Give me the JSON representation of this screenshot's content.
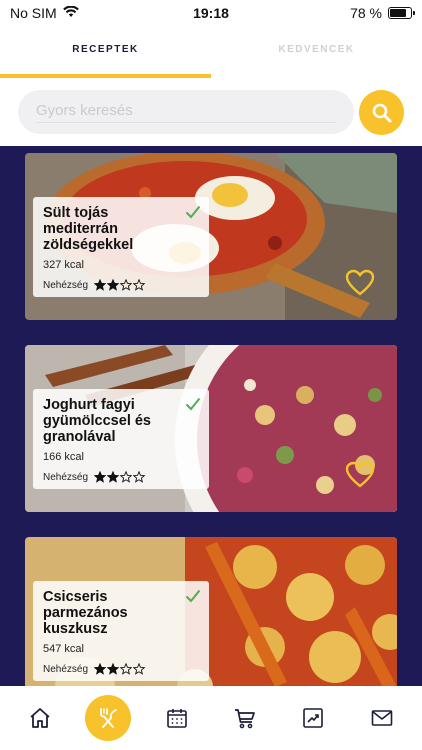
{
  "status_bar": {
    "carrier": "No SIM",
    "time": "19:18",
    "battery": "78 %",
    "battery_level": 0.78
  },
  "tabs": [
    {
      "label": "RECEPTEK",
      "active": true
    },
    {
      "label": "KEDVENCEK",
      "active": false
    }
  ],
  "search": {
    "placeholder": "Gyors keresés",
    "value": ""
  },
  "recipes": [
    {
      "title": "Sült tojás mediterrán zöldségekkel",
      "kcal": "327 kcal",
      "difficulty_label": "Nehézség",
      "difficulty": 2,
      "difficulty_max": 4
    },
    {
      "title": "Joghurt fagyi gyümölccsel és granolával",
      "kcal": "166 kcal",
      "difficulty_label": "Nehézség",
      "difficulty": 2,
      "difficulty_max": 4
    },
    {
      "title": "Csicseris parmezános kuszkusz",
      "kcal": "547 kcal",
      "difficulty_label": "Nehézség",
      "difficulty": 2,
      "difficulty_max": 4
    }
  ],
  "bottom_nav": [
    "home-icon",
    "cutlery-icon",
    "calendar-icon",
    "cart-icon",
    "chart-icon",
    "mail-icon"
  ],
  "colors": {
    "accent": "#f8c22c",
    "list_background": "#1d1a56",
    "check": "#4caf50"
  }
}
